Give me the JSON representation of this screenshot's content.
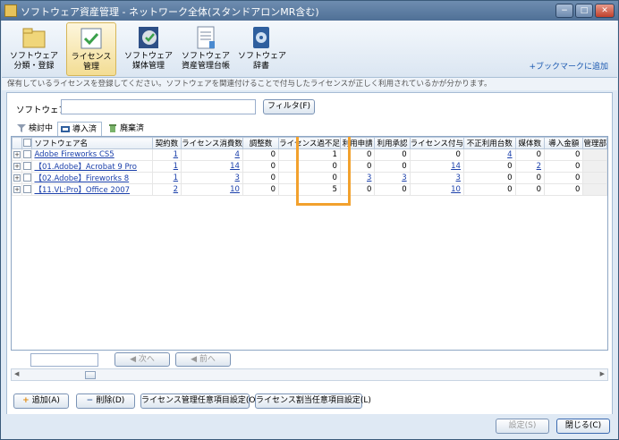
{
  "window": {
    "title": "ソフトウェア資産管理 - ネットワーク全体(スタンドアロンMR含む)",
    "minimize": "−",
    "maximize": "□",
    "close": "✕"
  },
  "ribbon": {
    "buttons": [
      {
        "label1": "ソフトウェア",
        "label2": "分類・登録",
        "icon": "folder-icon"
      },
      {
        "label1": "ライセンス",
        "label2": "管理",
        "icon": "license-icon"
      },
      {
        "label1": "ソフトウェア",
        "label2": "媒体管理",
        "icon": "media-icon"
      },
      {
        "label1": "ソフトウェア",
        "label2": "資産管理台帳",
        "icon": "ledger-icon"
      },
      {
        "label1": "ソフトウェア",
        "label2": "辞書",
        "icon": "dictionary-icon"
      }
    ],
    "bookmark": "+ブックマークに追加"
  },
  "info": "保有しているライセンスを登録してください。ソフトウェアを関連付けることで付与したライセンスが正しく利用されているかが分かります。",
  "filter": {
    "label": "ソフトウェア名",
    "value": "",
    "button": "フィルタ(F)"
  },
  "tabs": [
    {
      "label": "検討中"
    },
    {
      "label": "導入済"
    },
    {
      "label": "廃棄済"
    }
  ],
  "table": {
    "headers": [
      "ソフトウェア名",
      "契約数",
      "ライセンス消費数",
      "調整数",
      "ライセンス過不足",
      "利用申請",
      "利用承認",
      "ライセンス付与",
      "不正利用台数",
      "媒体数",
      "導入金額",
      "管理部"
    ],
    "rows": [
      {
        "name": "Adobe Fireworks CS5",
        "c1": "1",
        "c2": "4",
        "c3": "0",
        "c4": "1",
        "c5": "0",
        "c6": "0",
        "c7": "0",
        "c8": "4",
        "c9": "0",
        "c10": "0"
      },
      {
        "name": "【01.Adobe】Acrobat 9 Pro",
        "c1": "1",
        "c2": "14",
        "c3": "0",
        "c4": "0",
        "c5": "0",
        "c6": "0",
        "c7": "14",
        "c8": "0",
        "c9": "2",
        "c10": "0"
      },
      {
        "name": "【02.Adobe】Fireworks 8",
        "c1": "1",
        "c2": "3",
        "c3": "0",
        "c4": "0",
        "c5": "3",
        "c6": "3",
        "c7": "3",
        "c8": "0",
        "c9": "0",
        "c10": "0"
      },
      {
        "name": "【11.VL:Pro】Office 2007",
        "c1": "2",
        "c2": "10",
        "c3": "0",
        "c4": "5",
        "c5": "0",
        "c6": "0",
        "c7": "10",
        "c8": "0",
        "c9": "0",
        "c10": "0"
      }
    ]
  },
  "find": {
    "value": "",
    "next": "次へ",
    "prev": "前へ"
  },
  "actions": {
    "add": "追加(A)",
    "delete": "削除(D)",
    "license_custom": "ライセンス管理任意項目設定(O)",
    "assign_custom": "ライセンス割当任意項目設定(L)"
  },
  "footer": {
    "settings": "設定(S)",
    "close": "閉じる(C)"
  }
}
